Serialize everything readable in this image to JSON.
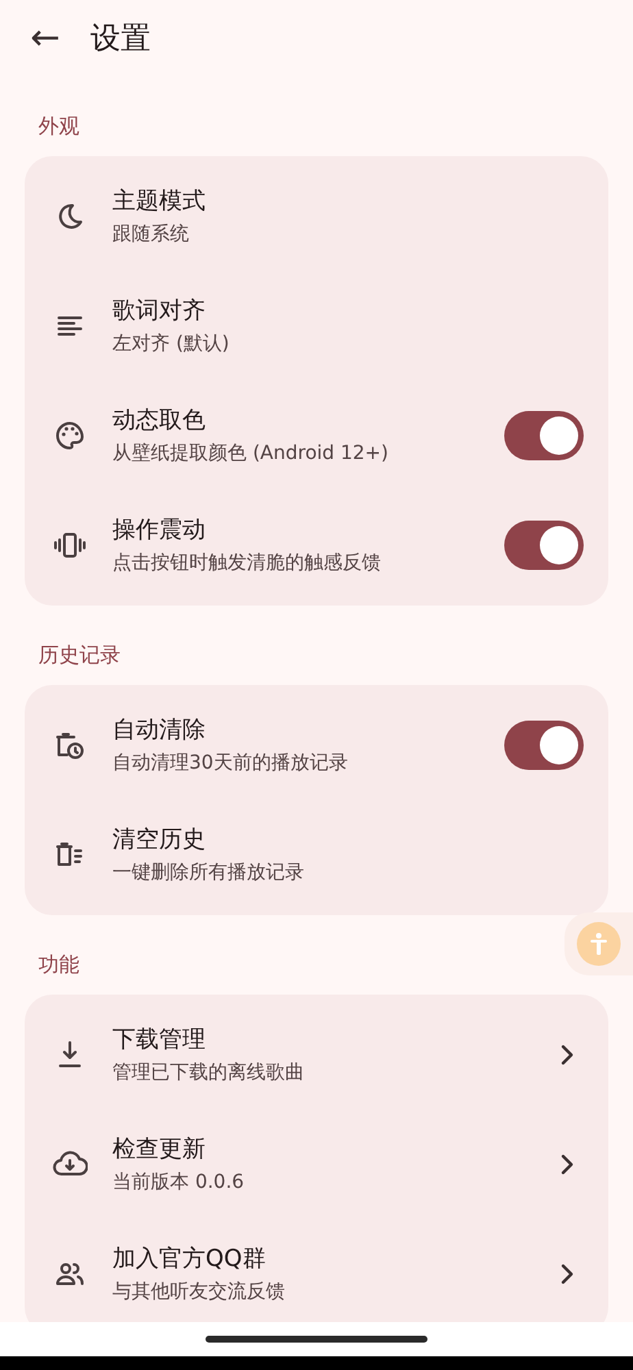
{
  "header": {
    "back": "←",
    "title": "设置"
  },
  "sections": [
    {
      "title": "外观",
      "items": [
        {
          "kind": "plain",
          "title": "主题模式",
          "subtitle": "跟随系统"
        },
        {
          "kind": "plain",
          "title": "歌词对齐",
          "subtitle": "左对齐 (默认)"
        },
        {
          "kind": "toggle",
          "title": "动态取色",
          "subtitle": "从壁纸提取颜色 (Android 12+)",
          "on": true
        },
        {
          "kind": "toggle",
          "title": "操作震动",
          "subtitle": "点击按钮时触发清脆的触感反馈",
          "on": true
        }
      ]
    },
    {
      "title": "历史记录",
      "items": [
        {
          "kind": "toggle",
          "title": "自动清除",
          "subtitle": "自动清理30天前的播放记录",
          "on": true
        },
        {
          "kind": "plain",
          "title": "清空历史",
          "subtitle": "一键删除所有播放记录"
        }
      ]
    },
    {
      "title": "功能",
      "items": [
        {
          "kind": "chevron",
          "title": "下载管理",
          "subtitle": "管理已下载的离线歌曲"
        },
        {
          "kind": "chevron",
          "title": "检查更新",
          "subtitle": "当前版本 0.0.6"
        },
        {
          "kind": "chevron",
          "title": "加入官方QQ群",
          "subtitle": "与其他听友交流反馈"
        }
      ]
    }
  ]
}
